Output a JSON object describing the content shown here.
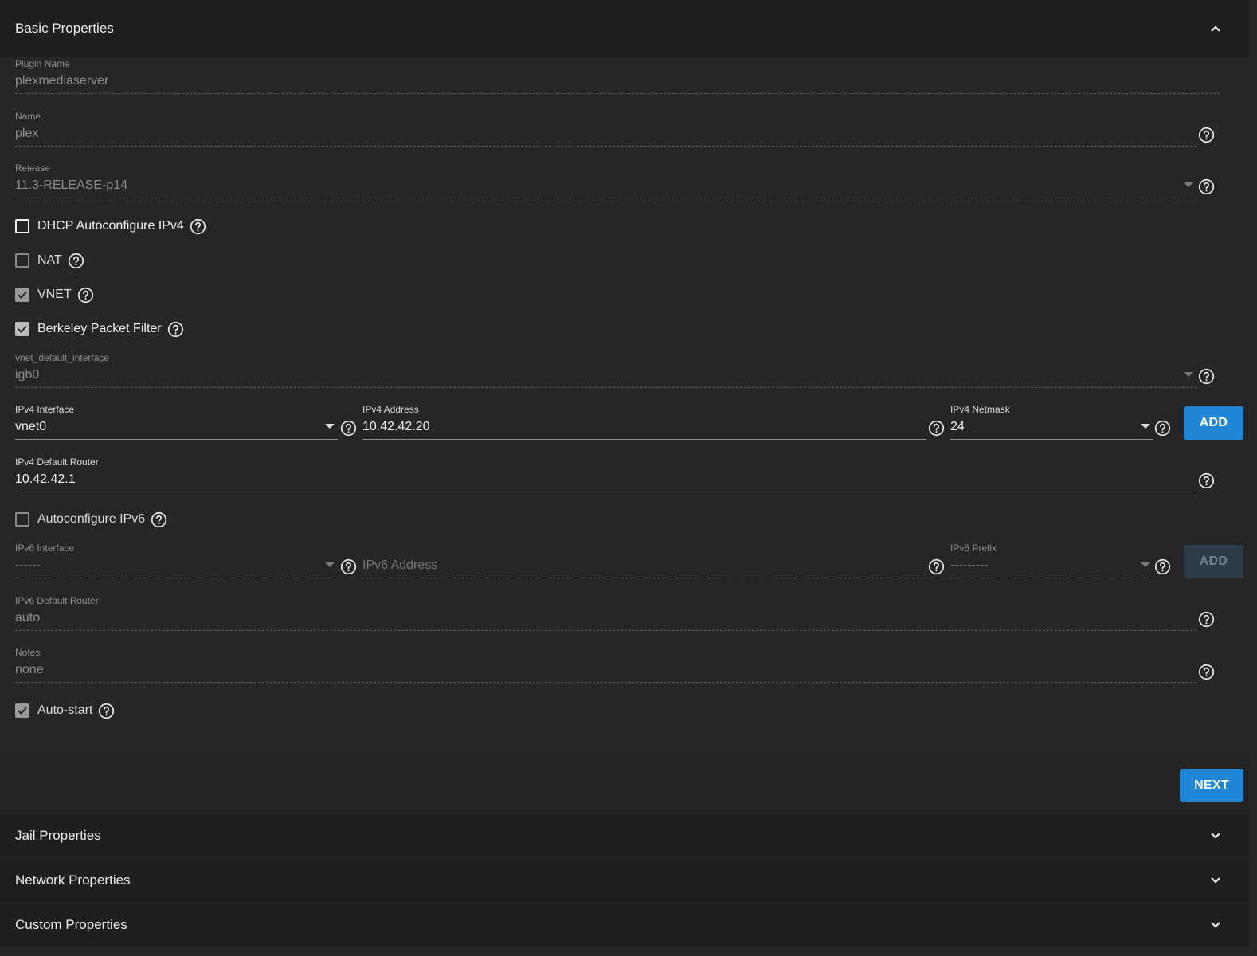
{
  "sections": {
    "basic": "Basic Properties",
    "jail": "Jail Properties",
    "network": "Network Properties",
    "custom": "Custom Properties"
  },
  "fields": {
    "plugin_name": {
      "label": "Plugin Name",
      "value": "plexmediaserver"
    },
    "name": {
      "label": "Name",
      "value": "plex"
    },
    "release": {
      "label": "Release",
      "value": "11.3-RELEASE-p14"
    },
    "vnet_default_interface": {
      "label": "vnet_default_interface",
      "value": "igb0"
    },
    "ipv4_interface": {
      "label": "IPv4 Interface",
      "value": "vnet0"
    },
    "ipv4_address": {
      "label": "IPv4 Address",
      "value": "10.42.42.20"
    },
    "ipv4_netmask": {
      "label": "IPv4 Netmask",
      "value": "24"
    },
    "ipv4_default_router": {
      "label": "IPv4 Default Router",
      "value": "10.42.42.1"
    },
    "ipv6_interface": {
      "label": "IPv6 Interface",
      "value": "------"
    },
    "ipv6_address": {
      "placeholder": "IPv6 Address"
    },
    "ipv6_prefix": {
      "label": "IPv6 Prefix",
      "value": "---------"
    },
    "ipv6_default_router": {
      "label": "IPv6 Default Router",
      "value": "auto"
    },
    "notes": {
      "label": "Notes",
      "value": "none"
    }
  },
  "checkboxes": {
    "dhcp": {
      "label": "DHCP Autoconfigure IPv4",
      "checked": false
    },
    "nat": {
      "label": "NAT",
      "checked": false
    },
    "vnet": {
      "label": "VNET",
      "checked": true
    },
    "bpf": {
      "label": "Berkeley Packet Filter",
      "checked": true
    },
    "autoconf_ipv6": {
      "label": "Autoconfigure IPv6",
      "checked": false
    },
    "autostart": {
      "label": "Auto-start",
      "checked": true
    }
  },
  "buttons": {
    "add_ipv4": "ADD",
    "add_ipv6": "ADD",
    "next": "NEXT"
  },
  "colors": {
    "background": "#262626",
    "header": "#1f1f1f",
    "primary": "#1f87d6"
  }
}
